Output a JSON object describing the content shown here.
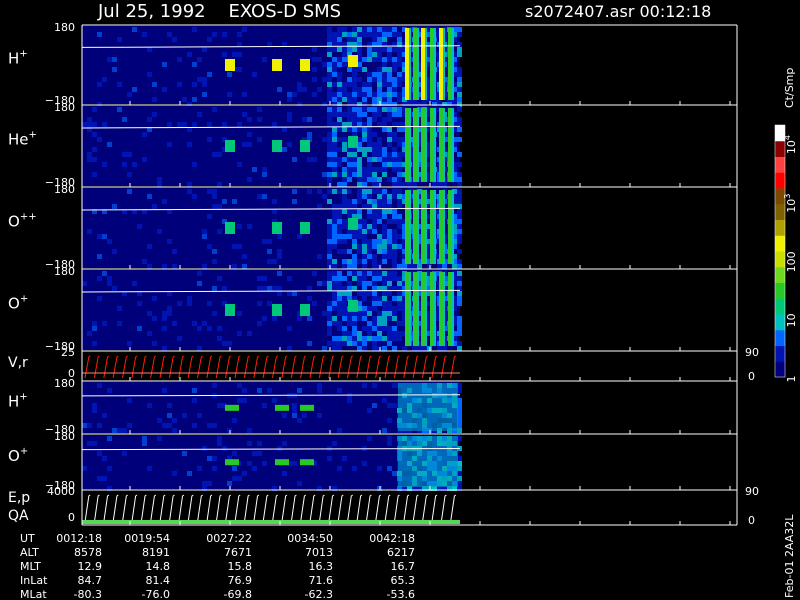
{
  "header": {
    "title": "Jul 25, 1992    EXOS-D SMS",
    "file_label": "s2072407.asr  00:12:18"
  },
  "colorbar": {
    "unit_label": "Ct/Smp",
    "ticks": [
      {
        "label": "10",
        "sup": "4",
        "value": 10000
      },
      {
        "label": "10",
        "sup": "3",
        "value": 1000
      },
      {
        "label": "100",
        "sup": "",
        "value": 100
      },
      {
        "label": "10",
        "sup": "",
        "value": 10
      },
      {
        "label": "1",
        "sup": "",
        "value": 1
      }
    ],
    "colors": [
      "#00007a",
      "#0014b4",
      "#0066ff",
      "#00c0c0",
      "#00c878",
      "#28c828",
      "#70d820",
      "#c8e000",
      "#f0f000",
      "#b0a000",
      "#806000",
      "#7a4a00",
      "#ff0000",
      "#ff4040",
      "#8b0000",
      "#ffffff"
    ]
  },
  "chart_data": [
    {
      "type": "heatmap",
      "panel": "H+ (1)",
      "ylabel": "H",
      "ylabel_sup": "+",
      "y_top": "180",
      "y_bottom": "-180",
      "ylim": [
        -180,
        180
      ]
    },
    {
      "type": "heatmap",
      "panel": "He+",
      "ylabel": "He",
      "ylabel_sup": "+",
      "y_top": "180",
      "y_bottom": "-180",
      "ylim": [
        -180,
        180
      ]
    },
    {
      "type": "heatmap",
      "panel": "O++",
      "ylabel": "O",
      "ylabel_sup": "++",
      "y_top": "180",
      "y_bottom": "-180",
      "ylim": [
        -180,
        180
      ]
    },
    {
      "type": "heatmap",
      "panel": "O+ (1)",
      "ylabel": "O",
      "ylabel_sup": "+",
      "y_top": "180",
      "y_bottom": "-180",
      "ylim": [
        -180,
        180
      ]
    },
    {
      "type": "line",
      "panel": "V,r",
      "ylabel": "V,r",
      "y_top": "25",
      "y_bottom": "0",
      "right_top": "90",
      "right_bottom": "0"
    },
    {
      "type": "heatmap",
      "panel": "H+ (2)",
      "ylabel": "H",
      "ylabel_sup": "+",
      "y_top": "180",
      "y_bottom": "-180",
      "ylim": [
        -180,
        180
      ]
    },
    {
      "type": "heatmap",
      "panel": "O+ (2)",
      "ylabel": "O",
      "ylabel_sup": "+",
      "y_top": "180",
      "y_bottom": "-180",
      "ylim": [
        -180,
        180
      ]
    },
    {
      "type": "line",
      "panel": "E,p / QA",
      "ylabel": "E,p",
      "ylabel2": "QA",
      "y_top": "4000",
      "y_bottom": "0",
      "right_top": "90",
      "right_bottom": "0"
    }
  ],
  "time_table": {
    "rows": [
      {
        "label": "UT",
        "values": [
          "0012:18",
          "0019:54",
          "0027:22",
          "0034:50",
          "0042:18"
        ]
      },
      {
        "label": "ALT",
        "values": [
          "8578",
          "8191",
          "7671",
          "7013",
          "6217"
        ]
      },
      {
        "label": "MLT",
        "values": [
          "12.9",
          "14.8",
          "15.8",
          "16.3",
          "16.7"
        ]
      },
      {
        "label": "InLat",
        "values": [
          "84.7",
          "81.4",
          "76.9",
          "71.6",
          "65.3"
        ]
      },
      {
        "label": "MLat",
        "values": [
          "-80.3",
          "-76.0",
          "-69.8",
          "-62.3",
          "-53.6"
        ]
      }
    ]
  },
  "footer_vertical": "Feb-01 2AA32L"
}
